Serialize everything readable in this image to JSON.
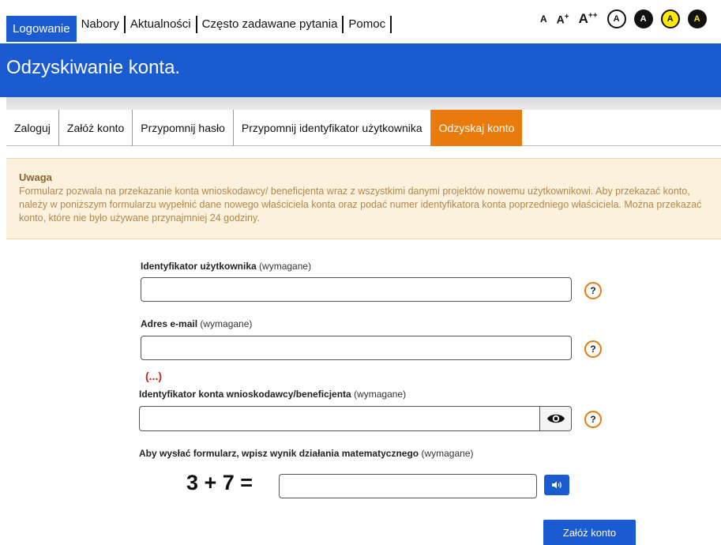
{
  "topnav": {
    "items": [
      "Logowanie",
      "Nabory",
      "Aktualności",
      "Często zadawane pytania",
      "Pomoc"
    ],
    "font_sizes": [
      "A",
      "A",
      "A"
    ],
    "font_size_sups": [
      "",
      "+",
      "++"
    ],
    "contrast_labels": [
      "A",
      "A",
      "A",
      "A"
    ]
  },
  "banner": {
    "title": "Odzyskiwanie konta."
  },
  "tabs": [
    "Zaloguj",
    "Załóż konto",
    "Przypomnij hasło",
    "Przypomnij identyfikator użytkownika",
    "Odzyskaj konto"
  ],
  "notice": {
    "title": "Uwaga",
    "body": "Formularz pozwala na przekazanie konta wnioskodawcy/ beneficjenta wraz z wszystkimi danymi projektów nowemu użytkownikowi. Aby przekazać konto, należy w poniższym formularzu wypełnić dane nowego właściciela konta oraz podać numer identyfikatora konta poprzedniego właściciela. Można przekazać konto, które nie było używane przynajmniej 24 godziny."
  },
  "form": {
    "user_id_label": "Identyfikator użytkownika",
    "email_label": "Adres e-mail",
    "account_id_label": "Identyfikator konta wnioskodawcy/beneficjenta",
    "captcha_label": "Aby wysłać formularz, wpisz wynik działania matematycznego",
    "required": "(wymagane)",
    "help": "?",
    "ellipsis": "(...)",
    "captcha_expr": "3 + 7 =",
    "submit": "Załóż konto"
  },
  "colors": {
    "primary": "#1a5bd1",
    "active_tab": "#e87b0c",
    "notice_bg": "#fcf1dd"
  }
}
